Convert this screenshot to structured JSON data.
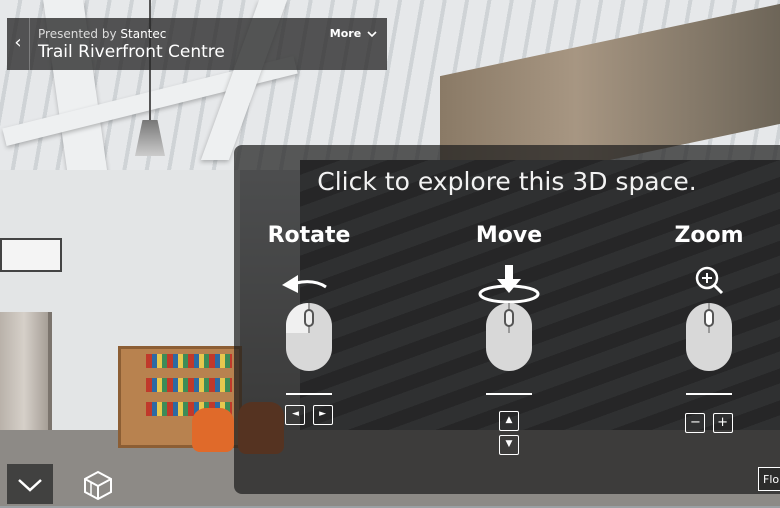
{
  "header": {
    "presented_prefix": "Presented by",
    "presenter": "Stantec",
    "title": "Trail Riverfront Centre",
    "more_label": "More"
  },
  "overlay": {
    "headline": "Click to explore this 3D space.",
    "columns": [
      {
        "label": "Rotate",
        "gesture_icon": "rotate-arrow-icon",
        "keys": [
          "◄",
          "►"
        ]
      },
      {
        "label": "Move",
        "gesture_icon": "move-down-arrow-icon",
        "keys": [
          "▲",
          "▼"
        ]
      },
      {
        "label": "Zoom",
        "gesture_icon": "zoom-in-icon",
        "keys": [
          "−",
          "+"
        ]
      }
    ]
  },
  "controls": {
    "floor_label": "Flo"
  }
}
